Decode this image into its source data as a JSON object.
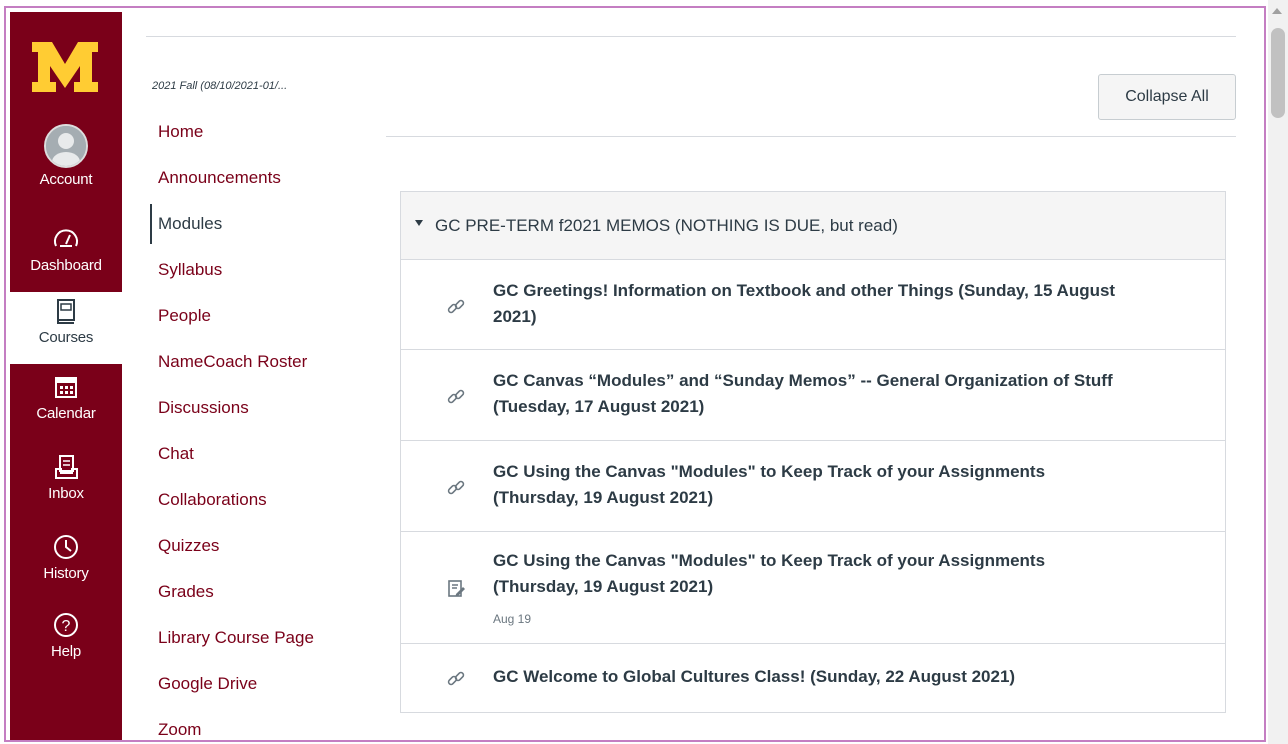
{
  "global_nav": {
    "items": [
      {
        "label": "Account",
        "icon": "account-avatar-icon"
      },
      {
        "label": "Dashboard",
        "icon": "dashboard-gauge-icon"
      },
      {
        "label": "Courses",
        "icon": "courses-book-icon",
        "active": true
      },
      {
        "label": "Calendar",
        "icon": "calendar-icon"
      },
      {
        "label": "Inbox",
        "icon": "inbox-icon"
      },
      {
        "label": "History",
        "icon": "history-clock-icon"
      },
      {
        "label": "Help",
        "icon": "help-question-icon"
      }
    ],
    "colors": {
      "background": "#7a0019",
      "logo": "#ffcc33"
    }
  },
  "course_nav": {
    "term": "2021 Fall (08/10/2021-01/...",
    "items": [
      "Home",
      "Announcements",
      "Modules",
      "Syllabus",
      "People",
      "NameCoach Roster",
      "Discussions",
      "Chat",
      "Collaborations",
      "Quizzes",
      "Grades",
      "Library Course Page",
      "Google Drive",
      "Zoom"
    ],
    "active": "Modules"
  },
  "toolbar": {
    "collapse_all_label": "Collapse All"
  },
  "module": {
    "title": "GC PRE-TERM f2021 MEMOS (NOTHING IS DUE, but read)",
    "items": [
      {
        "title": "GC Greetings! Information on Textbook and other Things (Sunday, 15 August 2021)",
        "icon": "link-icon"
      },
      {
        "title": "GC Canvas “Modules” and “Sunday Memos” -- General Organization of Stuff (Tuesday, 17 August 2021)",
        "icon": "link-icon"
      },
      {
        "title": "GC Using the Canvas \"Modules\" to Keep Track of your Assignments (Thursday, 19 August 2021)",
        "icon": "link-icon"
      },
      {
        "title": "GC Using the Canvas \"Modules\" to Keep Track of your Assignments (Thursday, 19 August 2021)",
        "icon": "page-edit-icon",
        "date": "Aug 19"
      },
      {
        "title": "GC Welcome to Global Cultures Class! (Sunday, 22 August 2021)",
        "icon": "link-icon"
      }
    ]
  }
}
